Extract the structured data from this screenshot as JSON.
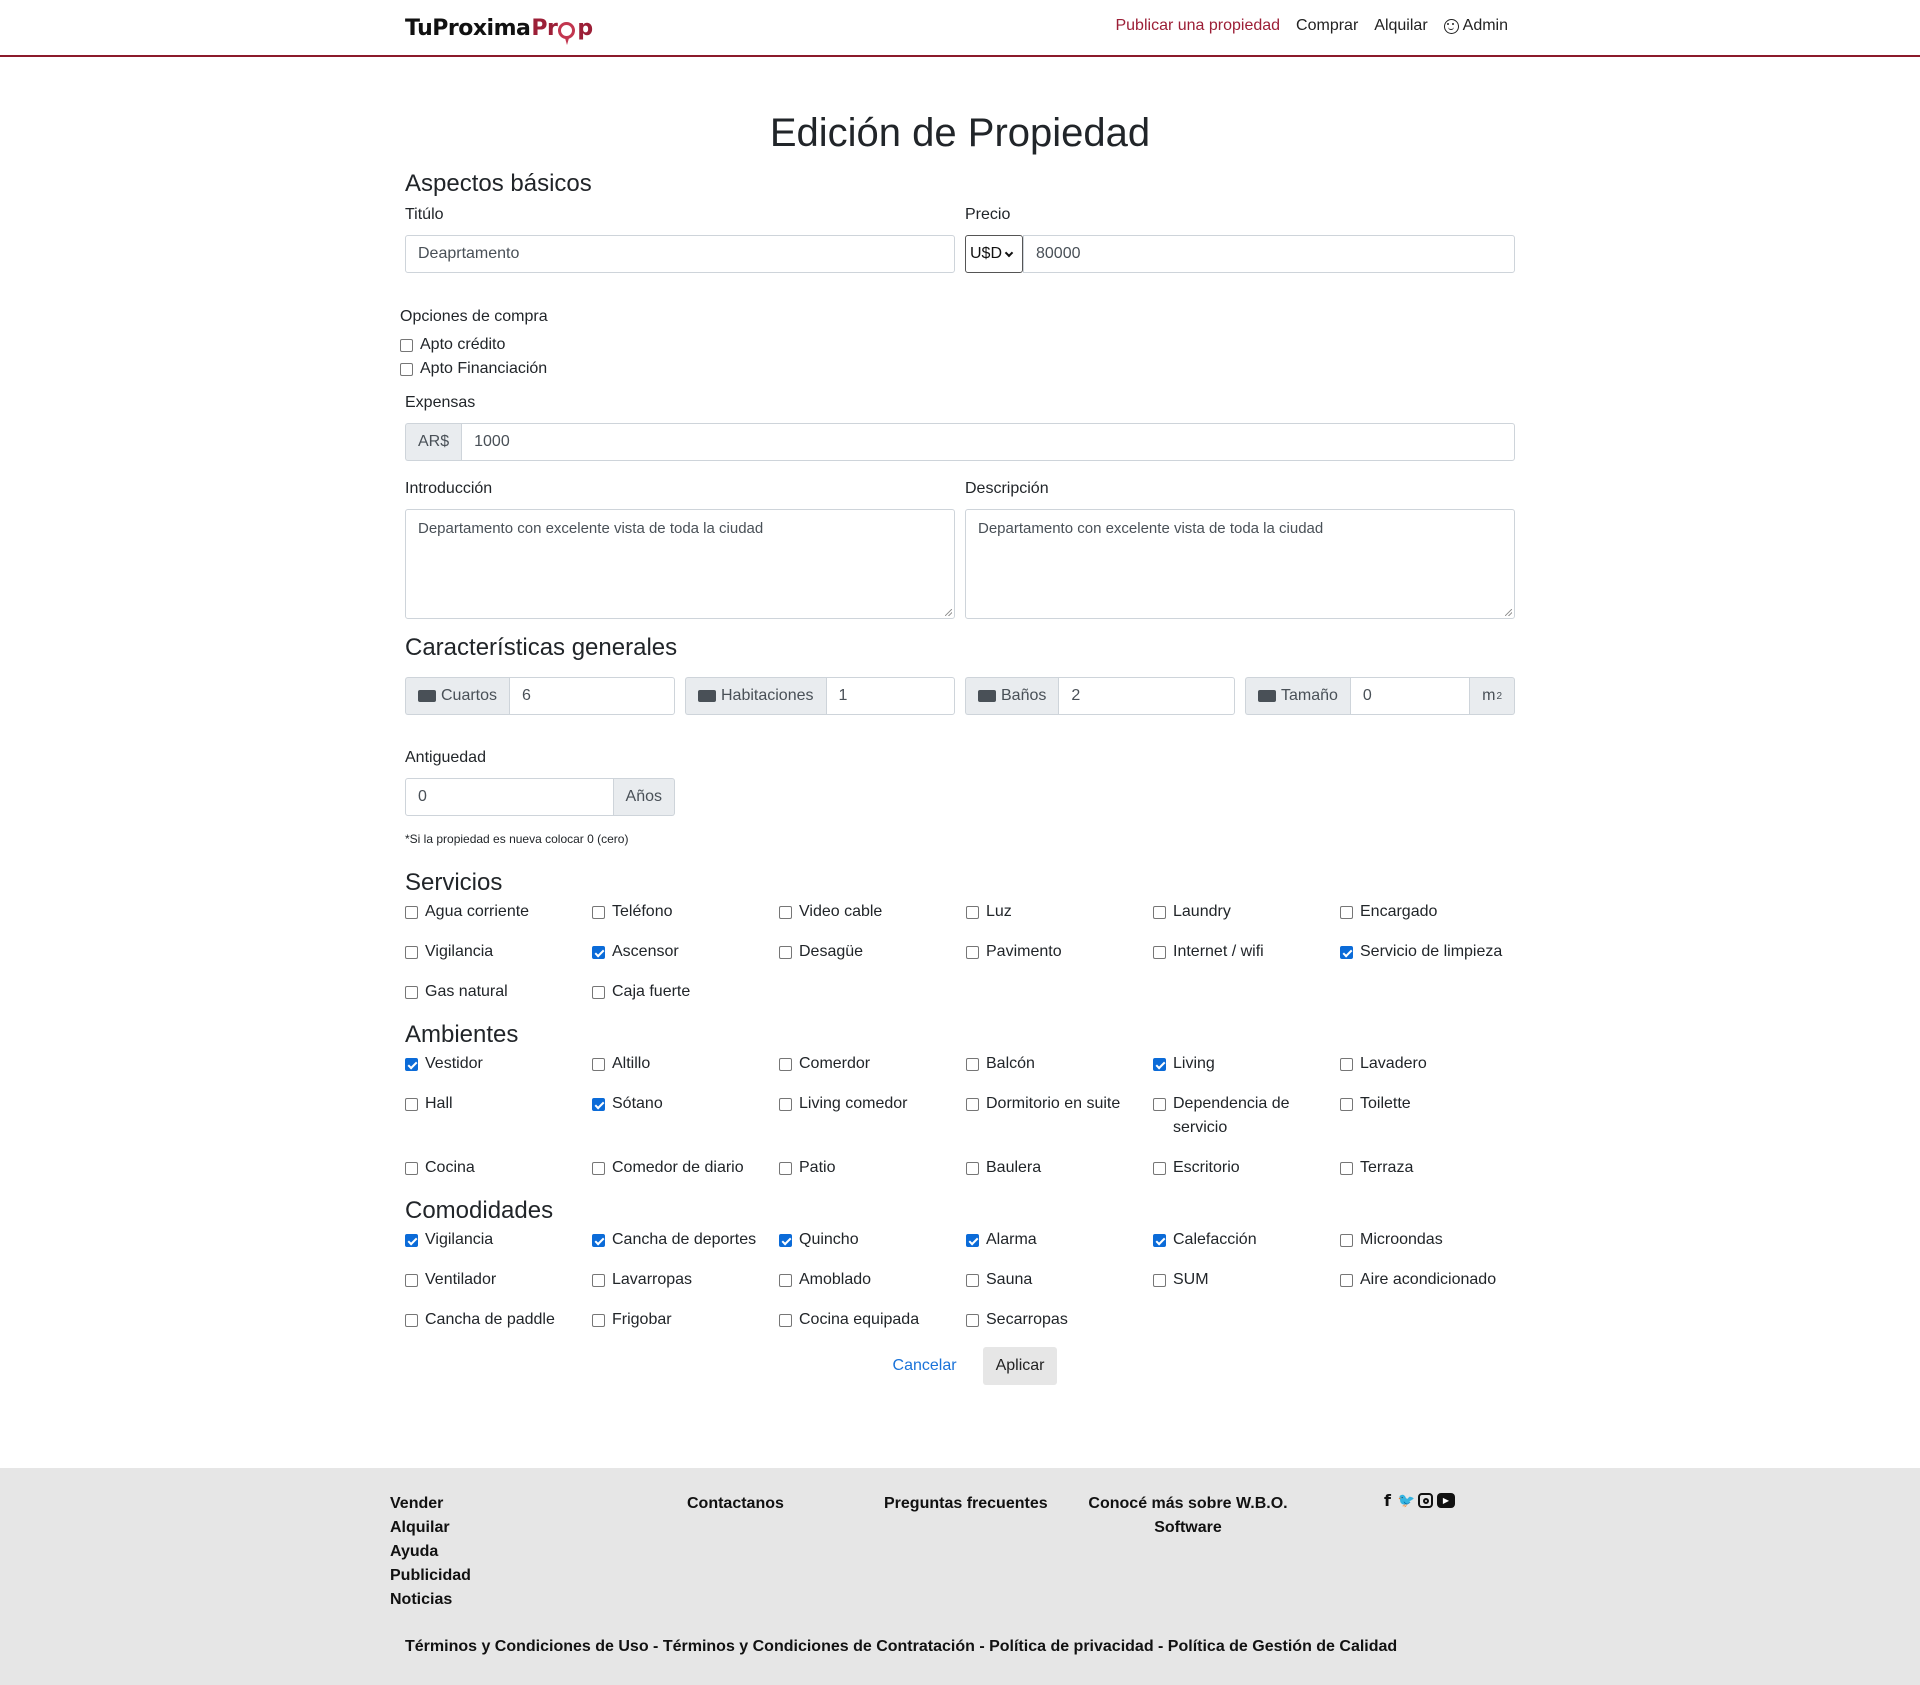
{
  "header": {
    "logo": {
      "part1": "TuProxima",
      "part2a": "Pr",
      "part2b": "p"
    },
    "nav": {
      "publish": "Publicar una propiedad",
      "buy": "Comprar",
      "rent": "Alquilar",
      "admin": "Admin"
    }
  },
  "page": {
    "title": "Edición de Propiedad"
  },
  "basic": {
    "heading": "Aspectos básicos",
    "title_label": "Titúlo",
    "title_value": "Deaprtamento",
    "price_label": "Precio",
    "currency": "U$D",
    "price_value": "80000",
    "purchase_label": "Opciones de compra",
    "purchase_options": [
      {
        "label": "Apto crédito",
        "checked": false
      },
      {
        "label": "Apto Financiación",
        "checked": false
      }
    ],
    "expenses_label": "Expensas",
    "expenses_currency": "AR$",
    "expenses_value": "1000",
    "intro_label": "Introducción",
    "intro_value": "Departamento con excelente vista de toda la ciudad",
    "desc_label": "Descripción",
    "desc_value": "Departamento con excelente vista de toda la ciudad"
  },
  "general": {
    "heading": "Características generales",
    "rooms_label": "Cuartos",
    "rooms_value": "6",
    "rooms_icon": "couch-icon",
    "bedrooms_label": "Habitaciones",
    "bedrooms_value": "1",
    "bedrooms_icon": "bed-icon",
    "baths_label": "Baños",
    "baths_value": "2",
    "baths_icon": "bath-icon",
    "size_label": "Tamaño",
    "size_value": "0",
    "size_unit": "m",
    "size_icon": "ruler-icon",
    "age_label": "Antiguedad",
    "age_value": "0",
    "age_unit": "Años",
    "age_note": "*Si la propiedad es nueva colocar 0 (cero)"
  },
  "services": {
    "heading": "Servicios",
    "items": [
      {
        "label": "Agua corriente",
        "checked": false
      },
      {
        "label": "Teléfono",
        "checked": false
      },
      {
        "label": "Video cable",
        "checked": false
      },
      {
        "label": "Luz",
        "checked": false
      },
      {
        "label": "Laundry",
        "checked": false
      },
      {
        "label": "Encargado",
        "checked": false
      },
      {
        "label": "Vigilancia",
        "checked": false
      },
      {
        "label": "Ascensor",
        "checked": true
      },
      {
        "label": "Desagüe",
        "checked": false
      },
      {
        "label": "Pavimento",
        "checked": false
      },
      {
        "label": "Internet / wifi",
        "checked": false
      },
      {
        "label": "Servicio de limpieza",
        "checked": true
      },
      {
        "label": "Gas natural",
        "checked": false
      },
      {
        "label": "Caja fuerte",
        "checked": false
      }
    ]
  },
  "rooms": {
    "heading": "Ambientes",
    "items": [
      {
        "label": "Vestidor",
        "checked": true
      },
      {
        "label": "Altillo",
        "checked": false
      },
      {
        "label": "Comerdor",
        "checked": false
      },
      {
        "label": "Balcón",
        "checked": false
      },
      {
        "label": "Living",
        "checked": true
      },
      {
        "label": "Lavadero",
        "checked": false
      },
      {
        "label": "Hall",
        "checked": false
      },
      {
        "label": "Sótano",
        "checked": true
      },
      {
        "label": "Living comedor",
        "checked": false
      },
      {
        "label": "Dormitorio en suite",
        "checked": false
      },
      {
        "label": "Dependencia de servicio",
        "checked": false
      },
      {
        "label": "Toilette",
        "checked": false
      },
      {
        "label": "Cocina",
        "checked": false
      },
      {
        "label": "Comedor de diario",
        "checked": false
      },
      {
        "label": "Patio",
        "checked": false
      },
      {
        "label": "Baulera",
        "checked": false
      },
      {
        "label": "Escritorio",
        "checked": false
      },
      {
        "label": "Terraza",
        "checked": false
      }
    ]
  },
  "amenities": {
    "heading": "Comodidades",
    "items": [
      {
        "label": "Vigilancia",
        "checked": true
      },
      {
        "label": "Cancha de deportes",
        "checked": true
      },
      {
        "label": "Quincho",
        "checked": true
      },
      {
        "label": "Alarma",
        "checked": true
      },
      {
        "label": "Calefacción",
        "checked": true
      },
      {
        "label": "Microondas",
        "checked": false
      },
      {
        "label": "Ventilador",
        "checked": false
      },
      {
        "label": "Lavarropas",
        "checked": false
      },
      {
        "label": "Amoblado",
        "checked": false
      },
      {
        "label": "Sauna",
        "checked": false
      },
      {
        "label": "SUM",
        "checked": false
      },
      {
        "label": "Aire acondicionado",
        "checked": false
      },
      {
        "label": "Cancha de paddle",
        "checked": false
      },
      {
        "label": "Frigobar",
        "checked": false
      },
      {
        "label": "Cocina equipada",
        "checked": false
      },
      {
        "label": "Secarropas",
        "checked": false
      }
    ]
  },
  "actions": {
    "cancel": "Cancelar",
    "apply": "Aplicar"
  },
  "footer": {
    "col1": [
      "Vender",
      "Alquilar",
      "Ayuda",
      "Publicidad",
      "Noticias"
    ],
    "contact": "Contactanos",
    "faq": "Preguntas frecuentes",
    "about_line1": "Conocé más sobre W.B.O.",
    "about_line2": "Software",
    "social_icons": [
      "facebook-icon",
      "twitter-icon",
      "instagram-icon",
      "youtube-icon"
    ],
    "legal": "Términos y Condiciones de Uso - Términos y Condiciones de Contratación - Política de privacidad - Política de Gestión de Calidad"
  }
}
